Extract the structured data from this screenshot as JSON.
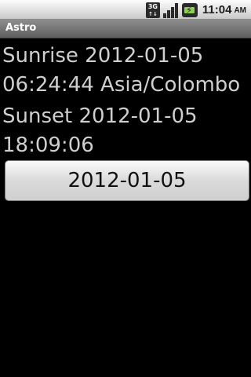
{
  "status_bar": {
    "network_label": "3G",
    "time": "11:04",
    "ampm": "AM",
    "icons": [
      "3g-data-icon",
      "signal-strength-icon",
      "battery-charging-icon"
    ]
  },
  "app": {
    "title": "Astro"
  },
  "content": {
    "sunrise_line1": "Sunrise 2012-01-05",
    "sunrise_line2": "06:24:44 Asia/Colombo",
    "sunset_line1": "Sunset 2012-01-05",
    "sunset_line2": "18:09:06"
  },
  "date_button": {
    "label": "2012-01-05"
  },
  "colors": {
    "background": "#000000",
    "text": "#cfcfcf",
    "title_bar": "#6e6e6e",
    "battery": "#8fd14f"
  }
}
